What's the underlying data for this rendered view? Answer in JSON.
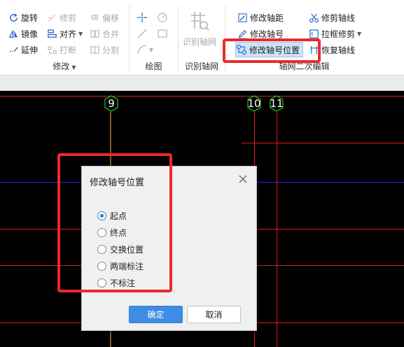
{
  "ribbon": {
    "modify": {
      "rotate": "旋转",
      "trim": "修剪",
      "offset": "偏移",
      "mirror": "镜像",
      "align": "对齐",
      "merge": "合并",
      "extend": "延伸",
      "break": "打断",
      "split": "分割",
      "group_label": "修改"
    },
    "draw": {
      "group_label": "绘图"
    },
    "identify": {
      "button": "识别轴网",
      "group_label": "识别轴网"
    },
    "grid_edit": {
      "modify_spacing": "修改轴距",
      "trim_axis": "修剪轴线",
      "modify_axis_number": "修改轴号",
      "box_trim": "拉框修剪",
      "modify_number_position": "修改轴号位置",
      "restore_axis": "恢复轴线",
      "group_label": "轴网二次编辑"
    }
  },
  "canvas": {
    "axis_labels": [
      "9",
      "10",
      "11"
    ]
  },
  "dialog": {
    "title": "修改轴号位置",
    "options": [
      "起点",
      "终点",
      "交换位置",
      "两端标注",
      "不标注"
    ],
    "selected_index": 0,
    "ok_label": "确定",
    "cancel_label": "取消"
  },
  "colors": {
    "canvas_bg": "#000000",
    "axis_red": "#e11b1b",
    "axis_green": "#1fb61f",
    "axis_blue": "#2424ee",
    "accent": "#3d8ce6",
    "annotation": "#ec2a2a"
  }
}
